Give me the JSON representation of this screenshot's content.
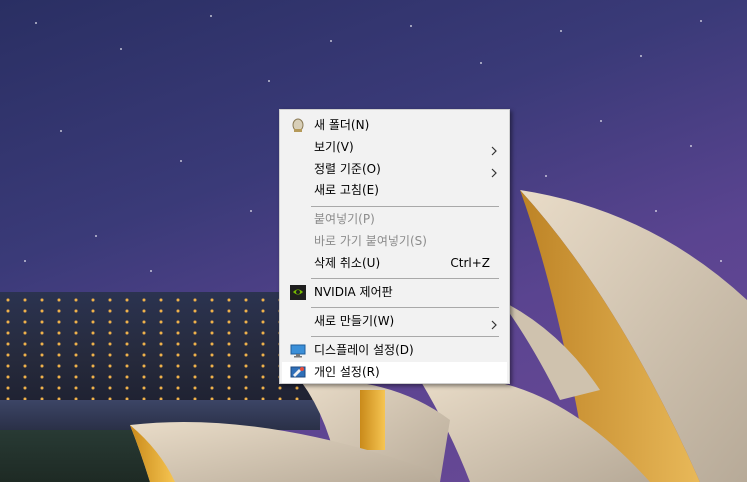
{
  "context_menu": {
    "items": [
      {
        "label": "새 폴더(N)",
        "icon": "new-folder-icon"
      },
      {
        "label": "보기(V)",
        "submenu": true
      },
      {
        "label": "정렬 기준(O)",
        "submenu": true
      },
      {
        "label": "새로 고침(E)"
      },
      {
        "label": "붙여넣기(P)",
        "disabled": true
      },
      {
        "label": "바로 가기 붙여넣기(S)",
        "disabled": true
      },
      {
        "label": "삭제 취소(U)",
        "shortcut": "Ctrl+Z"
      },
      {
        "label": "NVIDIA 제어판",
        "icon": "nvidia-icon"
      },
      {
        "label": "새로 만들기(W)",
        "submenu": true
      },
      {
        "label": "디스플레이 설정(D)",
        "icon": "display-icon"
      },
      {
        "label": "개인 설정(R)",
        "icon": "personalize-icon",
        "highlighted": true
      }
    ]
  },
  "colors": {
    "menu_background": "#f2f2f2",
    "disabled_text": "#8c8c8c",
    "highlight_background": "#ffffff"
  }
}
